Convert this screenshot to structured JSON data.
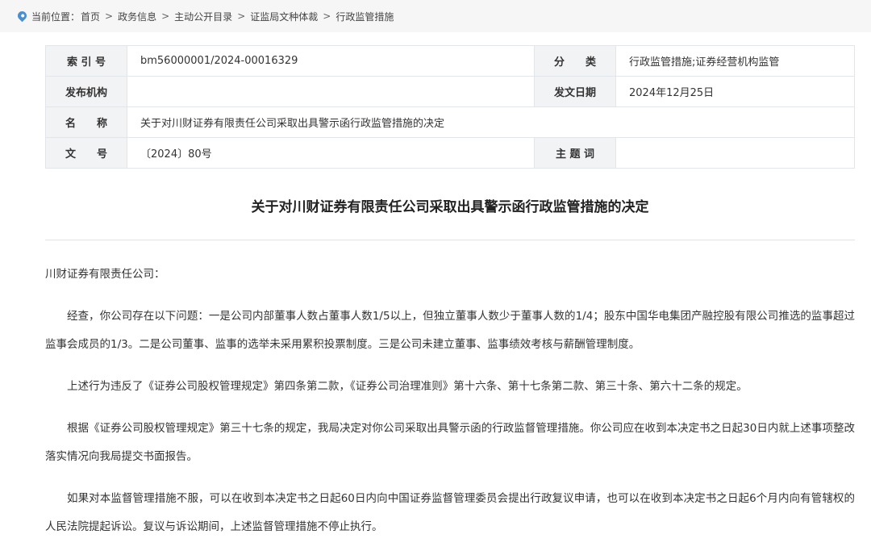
{
  "breadcrumb": {
    "prefix": "当前位置：",
    "items": [
      "首页",
      "政务信息",
      "主动公开目录",
      "证监局文种体裁",
      "行政监管措施"
    ],
    "separator": ">"
  },
  "meta": {
    "index_label": "索 引 号",
    "index_value": "bm56000001/2024-00016329",
    "category_label": "分　　类",
    "category_value": "行政监管措施;证券经营机构监管",
    "issuer_label": "发布机构",
    "issuer_value": "",
    "date_label": "发文日期",
    "date_value": "2024年12月25日",
    "name_label": "名　　称",
    "name_value": "关于对川财证券有限责任公司采取出具警示函行政监管措施的决定",
    "docno_label": "文　　号",
    "docno_value": "〔2024〕80号",
    "subject_label": "主 题 词",
    "subject_value": ""
  },
  "document": {
    "title": "关于对川财证券有限责任公司采取出具警示函行政监管措施的决定",
    "salutation": "川财证券有限责任公司：",
    "paragraphs": [
      "经查，你公司存在以下问题：一是公司内部董事人数占董事人数1/5以上，但独立董事人数少于董事人数的1/4；股东中国华电集团产融控股有限公司推选的监事超过监事会成员的1/3。二是公司董事、监事的选举未采用累积投票制度。三是公司未建立董事、监事绩效考核与薪酬管理制度。",
      "上述行为违反了《证券公司股权管理规定》第四条第二款，《证券公司治理准则》第十六条、第十七条第二款、第三十条、第六十二条的规定。",
      "根据《证券公司股权管理规定》第三十七条的规定，我局决定对你公司采取出具警示函的行政监督管理措施。你公司应在收到本决定书之日起30日内就上述事项整改落实情况向我局提交书面报告。",
      "如果对本监督管理措施不服，可以在收到本决定书之日起60日内向中国证券监督管理委员会提出行政复议申请，也可以在收到本决定书之日起6个月内向有管辖权的人民法院提起诉讼。复议与诉讼期间，上述监督管理措施不停止执行。"
    ]
  }
}
